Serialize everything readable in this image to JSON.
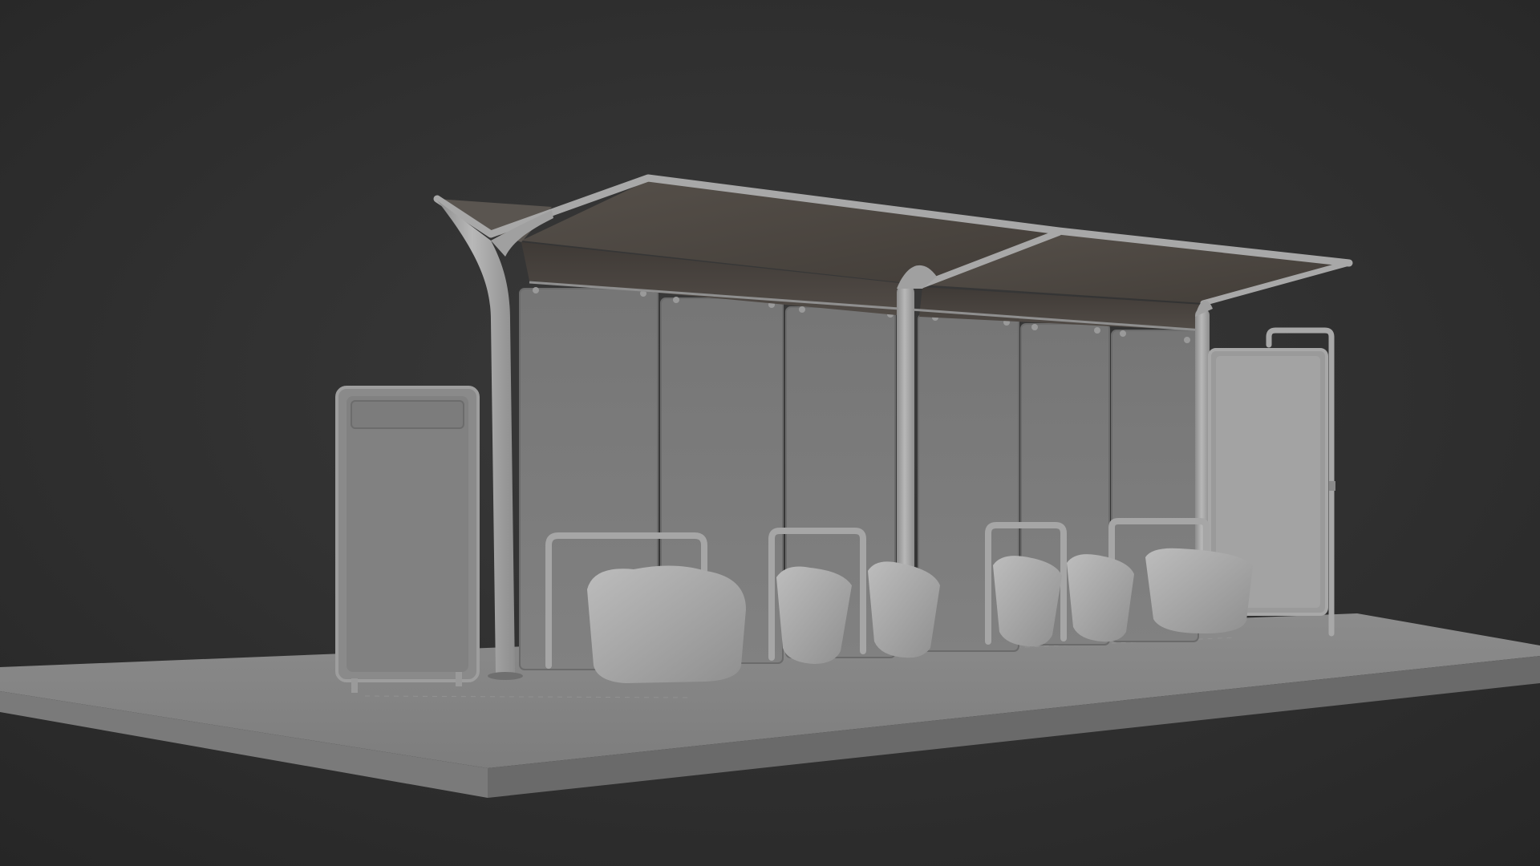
{
  "scene": {
    "title": "",
    "background_color": "#2a2a2a",
    "colors": {
      "platform_top": "#8a8a8a",
      "platform_side": "#6f6f6f",
      "platform_front": "#7e7e7e",
      "roof_panel": "#4e4843",
      "structure": "#a4a4a4",
      "back_panel": "#7a7a7a",
      "seat": "#a9a9a9",
      "sign_board": "#858585"
    },
    "objects": [
      "platform",
      "shelter-roof",
      "support-columns",
      "back-panels",
      "left-sign-board",
      "right-sign-board",
      "bike-racks",
      "seats"
    ]
  }
}
